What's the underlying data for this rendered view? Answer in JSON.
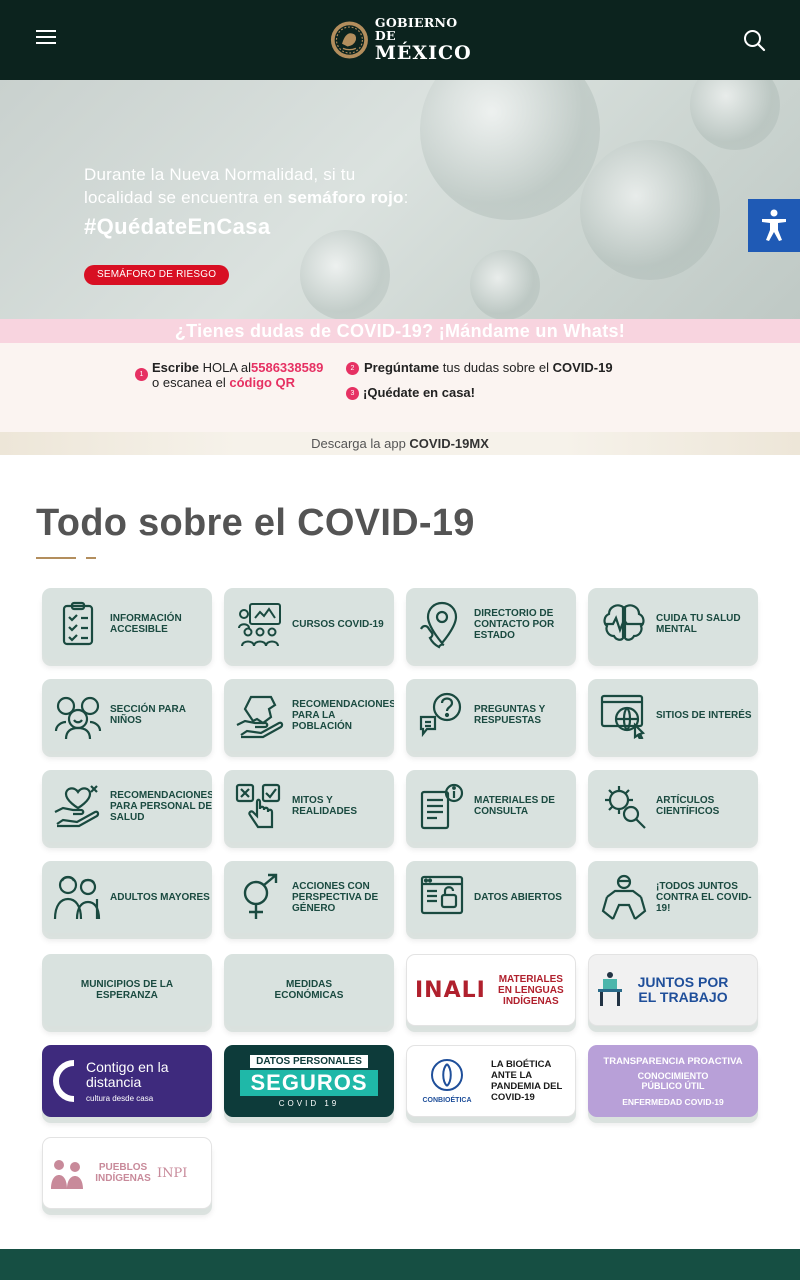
{
  "header": {
    "logo_line1": "GOBIERNO DE",
    "logo_line2": "MÉXICO",
    "menu_icon": "hamburger-icon",
    "search_icon": "search-icon"
  },
  "hero": {
    "line1": "Durante la Nueva Normalidad, si tu",
    "line2_pre": "localidad se encuentra en ",
    "line2_bold": "semáforo rojo",
    "line2_post": ":",
    "hashtag": "#QuédateEnCasa",
    "badge": "SEMÁFORO DE RIESGO",
    "accessibility_icon": "accessibility-icon"
  },
  "whatsapp": {
    "banner": "¿Tienes dudas de COVID-19? ¡Mándame un Whats!",
    "step1": {
      "num": "1",
      "bold": "Escribe",
      "text": " HOLA al",
      "phone": "5586338589",
      "line2": "o escanea el ",
      "qr": "código QR"
    },
    "step2": {
      "num": "2",
      "bold": "Pregúntame",
      "text": " tus dudas sobre el ",
      "bold2": "COVID-19"
    },
    "step3": {
      "num": "3",
      "bold": "¡Quédate en casa!"
    }
  },
  "download": {
    "text": "Descarga la app ",
    "bold": "COVID-19MX"
  },
  "section": {
    "title": "Todo sobre el COVID-19",
    "tiles": [
      {
        "label": "INFORMACIÓN ACCESIBLE",
        "icon": "checklist-icon"
      },
      {
        "label": "CURSOS COVID-19",
        "icon": "classroom-icon"
      },
      {
        "label": "DIRECTORIO DE CONTACTO POR ESTADO",
        "icon": "map-phone-icon"
      },
      {
        "label": "CUIDA TU SALUD MENTAL",
        "icon": "brain-pulse-icon"
      },
      {
        "label": "SECCIÓN PARA NIÑOS",
        "icon": "children-icon"
      },
      {
        "label": "RECOMENDACIONES PARA LA POBLACIÓN",
        "icon": "mexico-hand-icon"
      },
      {
        "label": "PREGUNTAS Y RESPUESTAS",
        "icon": "question-bubble-icon"
      },
      {
        "label": "SITIOS DE INTERÉS",
        "icon": "globe-cursor-icon"
      },
      {
        "label": "RECOMENDACIONES PARA PERSONAL DE SALUD",
        "icon": "heart-hand-icon"
      },
      {
        "label": "MITOS Y REALIDADES",
        "icon": "check-x-hand-icon"
      },
      {
        "label": "MATERIALES DE CONSULTA",
        "icon": "document-info-icon"
      },
      {
        "label": "ARTÍCULOS CIENTÍFICOS",
        "icon": "virus-magnifier-icon"
      },
      {
        "label": "ADULTOS MAYORES",
        "icon": "elderly-couple-icon"
      },
      {
        "label": "ACCIONES CON PERSPECTIVA DE GÉNERO",
        "icon": "gender-symbol-icon"
      },
      {
        "label": "DATOS ABIERTOS",
        "icon": "open-data-icon"
      },
      {
        "label": "¡TODOS JUNTOS CONTRA EL COVID-19!",
        "icon": "hands-together-icon"
      },
      {
        "label": "MUNICIPIOS DE LA ESPERANZA"
      },
      {
        "label": "MEDIDAS ECONÓMICAS"
      },
      {
        "label": "MATERIALES EN LENGUAS INDÍGENAS",
        "brand": "INALI"
      },
      {
        "label": "JUNTOS POR EL TRABAJO"
      },
      {
        "label": "Contigo en la distancia",
        "sub": "cultura desde casa"
      },
      {
        "label": "DATOS PERSONALES",
        "big": "SEGUROS",
        "sub": "COVID 19"
      },
      {
        "label": "LA BIOÉTICA ANTE LA PANDEMIA DEL COVID-19",
        "brand": "CONBIOÉTICA"
      },
      {
        "label": "TRANSPARENCIA PROACTIVA",
        "mid": "CONOCIMIENTO PÚBLICO ÚTIL",
        "sub": "ENFERMEDAD COVID-19"
      },
      {
        "label": "PUEBLOS INDÍGENAS",
        "brand": "INPI"
      }
    ]
  },
  "colors": {
    "navbar": "#0c231e",
    "accent_pink": "#e63163",
    "badge_red": "#d80f23",
    "gold": "#b38e5d",
    "tile_bg": "#d9e2df",
    "tile_text": "#1a4a40",
    "accessibility_blue": "#1f5ab5"
  }
}
